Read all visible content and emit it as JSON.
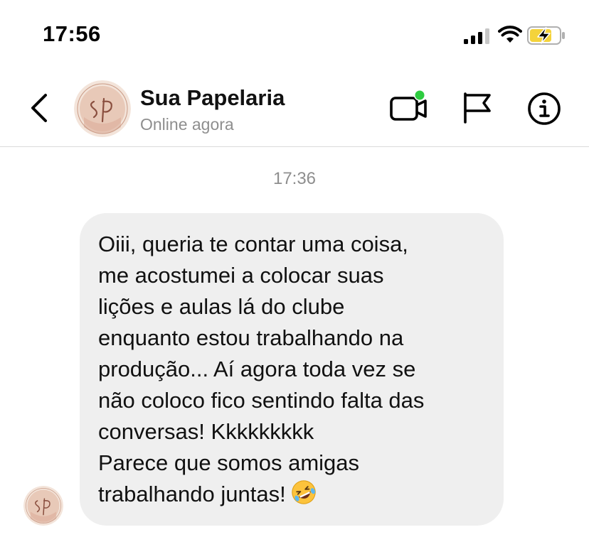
{
  "status_bar": {
    "time": "17:56"
  },
  "header": {
    "back_icon": "chevron-left-icon",
    "contact_name": "Sua Papelaria",
    "contact_status": "Online agora",
    "avatar": {
      "initials": "SP",
      "ring_text": "Sua Papelaria",
      "bg_color": "#e8c9b8"
    },
    "actions": [
      "video-call-icon",
      "flag-icon",
      "info-icon"
    ],
    "online_dot_color": "#2ecc40"
  },
  "chat": {
    "timestamp": "17:36",
    "messages": [
      {
        "sender": "Sua Papelaria",
        "text": "Oiii, queria te contar uma coisa,\nme acostumei a colocar suas\nlições e aulas lá do clube\nenquanto estou trabalhando na\nprodução... Aí agora toda vez se\nnão coloco fico sentindo falta das\nconversas! Kkkkkkkkk\nParece que somos amigas\ntrabalhando juntas!",
        "emoji": "rolling-on-floor-laughing-emoji"
      }
    ]
  },
  "colors": {
    "bubble_bg": "#efefef",
    "muted_text": "#8e8e8e",
    "divider": "#dbdbdb",
    "battery_fill": "#f4d33b"
  }
}
